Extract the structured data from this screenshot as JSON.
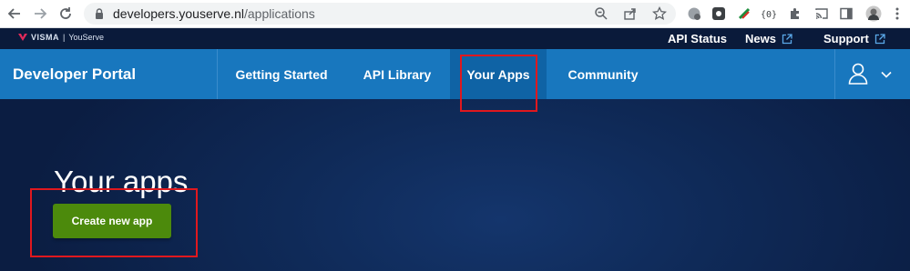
{
  "browser": {
    "url_host": "developers.youserve.nl",
    "url_path": "/applications",
    "icons": [
      "back-arrow-icon",
      "forward-arrow-icon",
      "reload-icon",
      "lock-icon",
      "zoom-icon",
      "share-icon",
      "bookmark-star-icon",
      "extensions-puzzle-icon",
      "cast-icon",
      "side-panel-icon",
      "profile-avatar-icon",
      "more-menu-icon"
    ]
  },
  "top_strip": {
    "brand_name": "VISMA",
    "brand_separator": "|",
    "brand_product": "YouServe",
    "links": [
      {
        "label": "API Status"
      },
      {
        "label": "News"
      },
      {
        "label": "Support"
      }
    ]
  },
  "nav": {
    "title": "Developer Portal",
    "items": [
      {
        "label": "Getting Started"
      },
      {
        "label": "API Library"
      },
      {
        "label": "Your Apps",
        "active": true
      },
      {
        "label": "Community"
      }
    ]
  },
  "main": {
    "title": "Your apps",
    "create_button_label": "Create new app"
  },
  "colors": {
    "nav_blue": "#1877be",
    "active_tab": "#0f63a5",
    "hero_dark": "#0b1d42",
    "button_green": "#4c8a0c",
    "highlight_red": "#e0181e"
  }
}
